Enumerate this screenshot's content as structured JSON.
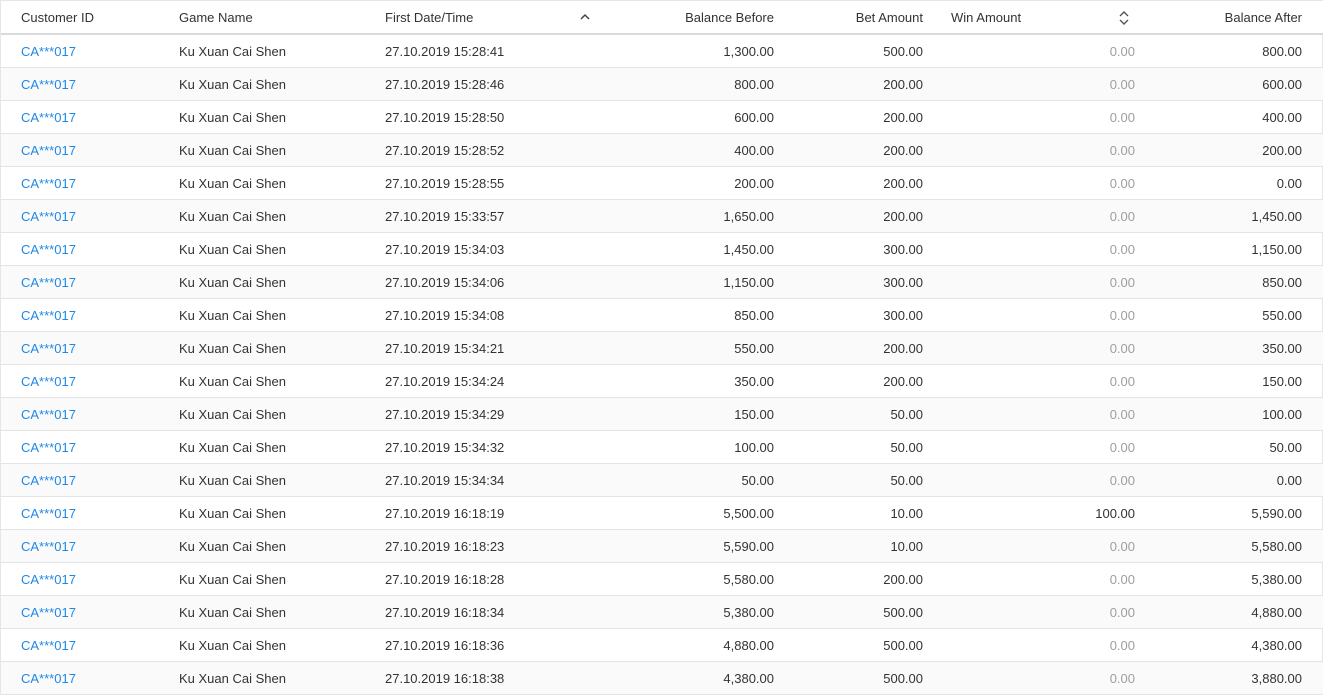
{
  "columns": {
    "customer_id": "Customer ID",
    "game_name": "Game Name",
    "first_datetime": "First Date/Time",
    "balance_before": "Balance Before",
    "bet_amount": "Bet Amount",
    "win_amount": "Win Amount",
    "balance_after": "Balance After"
  },
  "icons": {
    "sort_asc": "chevron-up-icon",
    "sort_both": "sort-updown-icon"
  },
  "colors": {
    "link": "#1e88e5",
    "muted": "#9e9e9e",
    "row_alt": "#fafafa"
  },
  "rows": [
    {
      "customer_id": "CA***017",
      "game_name": "Ku Xuan Cai Shen",
      "datetime": "27.10.2019 15:28:41",
      "balance_before": "1,300.00",
      "bet": "500.00",
      "win": "0.00",
      "balance_after": "800.00"
    },
    {
      "customer_id": "CA***017",
      "game_name": "Ku Xuan Cai Shen",
      "datetime": "27.10.2019 15:28:46",
      "balance_before": "800.00",
      "bet": "200.00",
      "win": "0.00",
      "balance_after": "600.00"
    },
    {
      "customer_id": "CA***017",
      "game_name": "Ku Xuan Cai Shen",
      "datetime": "27.10.2019 15:28:50",
      "balance_before": "600.00",
      "bet": "200.00",
      "win": "0.00",
      "balance_after": "400.00"
    },
    {
      "customer_id": "CA***017",
      "game_name": "Ku Xuan Cai Shen",
      "datetime": "27.10.2019 15:28:52",
      "balance_before": "400.00",
      "bet": "200.00",
      "win": "0.00",
      "balance_after": "200.00"
    },
    {
      "customer_id": "CA***017",
      "game_name": "Ku Xuan Cai Shen",
      "datetime": "27.10.2019 15:28:55",
      "balance_before": "200.00",
      "bet": "200.00",
      "win": "0.00",
      "balance_after": "0.00"
    },
    {
      "customer_id": "CA***017",
      "game_name": "Ku Xuan Cai Shen",
      "datetime": "27.10.2019 15:33:57",
      "balance_before": "1,650.00",
      "bet": "200.00",
      "win": "0.00",
      "balance_after": "1,450.00"
    },
    {
      "customer_id": "CA***017",
      "game_name": "Ku Xuan Cai Shen",
      "datetime": "27.10.2019 15:34:03",
      "balance_before": "1,450.00",
      "bet": "300.00",
      "win": "0.00",
      "balance_after": "1,150.00"
    },
    {
      "customer_id": "CA***017",
      "game_name": "Ku Xuan Cai Shen",
      "datetime": "27.10.2019 15:34:06",
      "balance_before": "1,150.00",
      "bet": "300.00",
      "win": "0.00",
      "balance_after": "850.00"
    },
    {
      "customer_id": "CA***017",
      "game_name": "Ku Xuan Cai Shen",
      "datetime": "27.10.2019 15:34:08",
      "balance_before": "850.00",
      "bet": "300.00",
      "win": "0.00",
      "balance_after": "550.00"
    },
    {
      "customer_id": "CA***017",
      "game_name": "Ku Xuan Cai Shen",
      "datetime": "27.10.2019 15:34:21",
      "balance_before": "550.00",
      "bet": "200.00",
      "win": "0.00",
      "balance_after": "350.00"
    },
    {
      "customer_id": "CA***017",
      "game_name": "Ku Xuan Cai Shen",
      "datetime": "27.10.2019 15:34:24",
      "balance_before": "350.00",
      "bet": "200.00",
      "win": "0.00",
      "balance_after": "150.00"
    },
    {
      "customer_id": "CA***017",
      "game_name": "Ku Xuan Cai Shen",
      "datetime": "27.10.2019 15:34:29",
      "balance_before": "150.00",
      "bet": "50.00",
      "win": "0.00",
      "balance_after": "100.00"
    },
    {
      "customer_id": "CA***017",
      "game_name": "Ku Xuan Cai Shen",
      "datetime": "27.10.2019 15:34:32",
      "balance_before": "100.00",
      "bet": "50.00",
      "win": "0.00",
      "balance_after": "50.00"
    },
    {
      "customer_id": "CA***017",
      "game_name": "Ku Xuan Cai Shen",
      "datetime": "27.10.2019 15:34:34",
      "balance_before": "50.00",
      "bet": "50.00",
      "win": "0.00",
      "balance_after": "0.00"
    },
    {
      "customer_id": "CA***017",
      "game_name": "Ku Xuan Cai Shen",
      "datetime": "27.10.2019 16:18:19",
      "balance_before": "5,500.00",
      "bet": "10.00",
      "win": "100.00",
      "balance_after": "5,590.00"
    },
    {
      "customer_id": "CA***017",
      "game_name": "Ku Xuan Cai Shen",
      "datetime": "27.10.2019 16:18:23",
      "balance_before": "5,590.00",
      "bet": "10.00",
      "win": "0.00",
      "balance_after": "5,580.00"
    },
    {
      "customer_id": "CA***017",
      "game_name": "Ku Xuan Cai Shen",
      "datetime": "27.10.2019 16:18:28",
      "balance_before": "5,580.00",
      "bet": "200.00",
      "win": "0.00",
      "balance_after": "5,380.00"
    },
    {
      "customer_id": "CA***017",
      "game_name": "Ku Xuan Cai Shen",
      "datetime": "27.10.2019 16:18:34",
      "balance_before": "5,380.00",
      "bet": "500.00",
      "win": "0.00",
      "balance_after": "4,880.00"
    },
    {
      "customer_id": "CA***017",
      "game_name": "Ku Xuan Cai Shen",
      "datetime": "27.10.2019 16:18:36",
      "balance_before": "4,880.00",
      "bet": "500.00",
      "win": "0.00",
      "balance_after": "4,380.00"
    },
    {
      "customer_id": "CA***017",
      "game_name": "Ku Xuan Cai Shen",
      "datetime": "27.10.2019 16:18:38",
      "balance_before": "4,380.00",
      "bet": "500.00",
      "win": "0.00",
      "balance_after": "3,880.00"
    }
  ]
}
